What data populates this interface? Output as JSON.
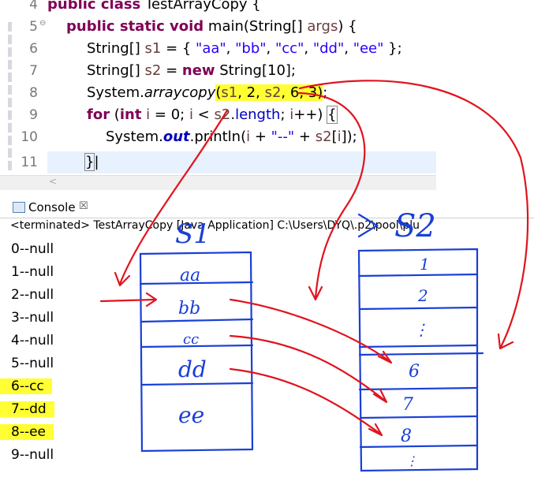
{
  "editor": {
    "lines": [
      {
        "num": "4",
        "code": "public class TestArrayCopy {"
      },
      {
        "num": "5",
        "code": "public static void main(String[] args) {"
      },
      {
        "num": "6",
        "code": "String[] s1 = { \"aa\", \"bb\", \"cc\", \"dd\", \"ee\" };"
      },
      {
        "num": "7",
        "code": "String[] s2 = new String[10];"
      },
      {
        "num": "8",
        "code": "System.arraycopy(s1, 2, s2, 6, 3);"
      },
      {
        "num": "9",
        "code": "for (int i = 0; i < s2.length; i++) {"
      },
      {
        "num": "10",
        "code": "System.out.println(i + \"--\" + s2[i]);"
      },
      {
        "num": "11",
        "code": "}"
      }
    ]
  },
  "console": {
    "tab_label": "Console",
    "close_symbol": "☒",
    "status": "<terminated> TestArrayCopy [Java Application] C:\\Users\\DYQ\\.p2\\pool\\plu",
    "output": [
      "0--null",
      "1--null",
      "2--null",
      "3--null",
      "4--null",
      "5--null",
      "6--cc",
      "7--dd",
      "8--ee",
      "9--null"
    ]
  },
  "annotation": {
    "s1_label": "S1",
    "s2_label": "S2",
    "s1_cells": [
      "aa",
      "bb",
      "cc",
      "dd",
      "ee"
    ],
    "s2_cells": [
      "1",
      "2",
      "⋮",
      "6",
      "7",
      "8",
      "⋮"
    ],
    "ink_color": "#1a3fd6",
    "arrow_color": "#e0141e"
  },
  "colors": {
    "keyword": "#7f0055",
    "string": "#2a00ff",
    "highlight": "#ffff33",
    "current_line": "#e8f2fe"
  }
}
